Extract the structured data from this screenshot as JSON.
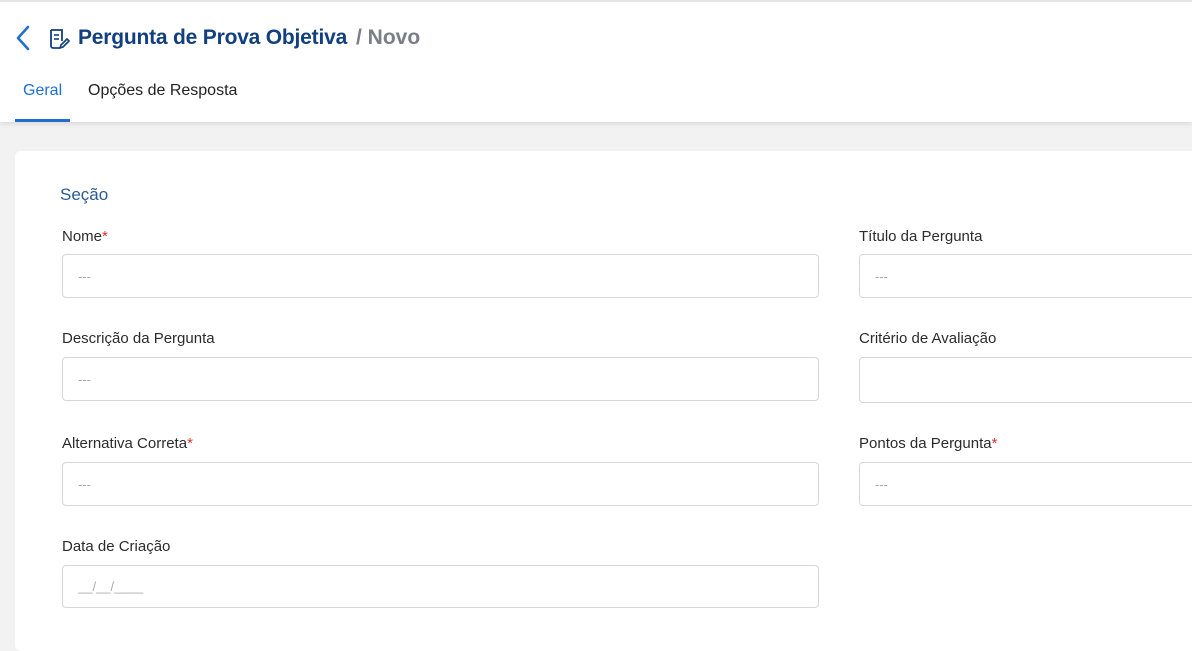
{
  "header": {
    "back_icon": "chevron-left-icon",
    "doc_icon": "document-edit-icon",
    "title": "Pergunta de Prova Objetiva",
    "subtitle": "/ Novo"
  },
  "tabs": [
    {
      "label": "Geral",
      "active": true
    },
    {
      "label": "Opções de Resposta",
      "active": false
    }
  ],
  "form": {
    "section_title": "Seção",
    "required_mark": "*",
    "fields": {
      "nome": {
        "label": "Nome",
        "placeholder": "---",
        "required": true
      },
      "titulo": {
        "label": "Título da Pergunta",
        "placeholder": "---",
        "required": false
      },
      "descricao": {
        "label": "Descrição da Pergunta",
        "placeholder": "---",
        "required": false
      },
      "criterio": {
        "label": "Critério de Avaliação",
        "placeholder": "",
        "required": false
      },
      "alternativa": {
        "label": "Alternativa Correta",
        "placeholder": "---",
        "required": true
      },
      "pontos": {
        "label": "Pontos da Pergunta",
        "placeholder": "---",
        "required": true
      },
      "data": {
        "label": "Data de Criação",
        "placeholder": "__/__/____",
        "required": false
      }
    }
  },
  "colors": {
    "accent": "#1f6fd1",
    "title": "#123f7f",
    "required": "#e03030"
  }
}
